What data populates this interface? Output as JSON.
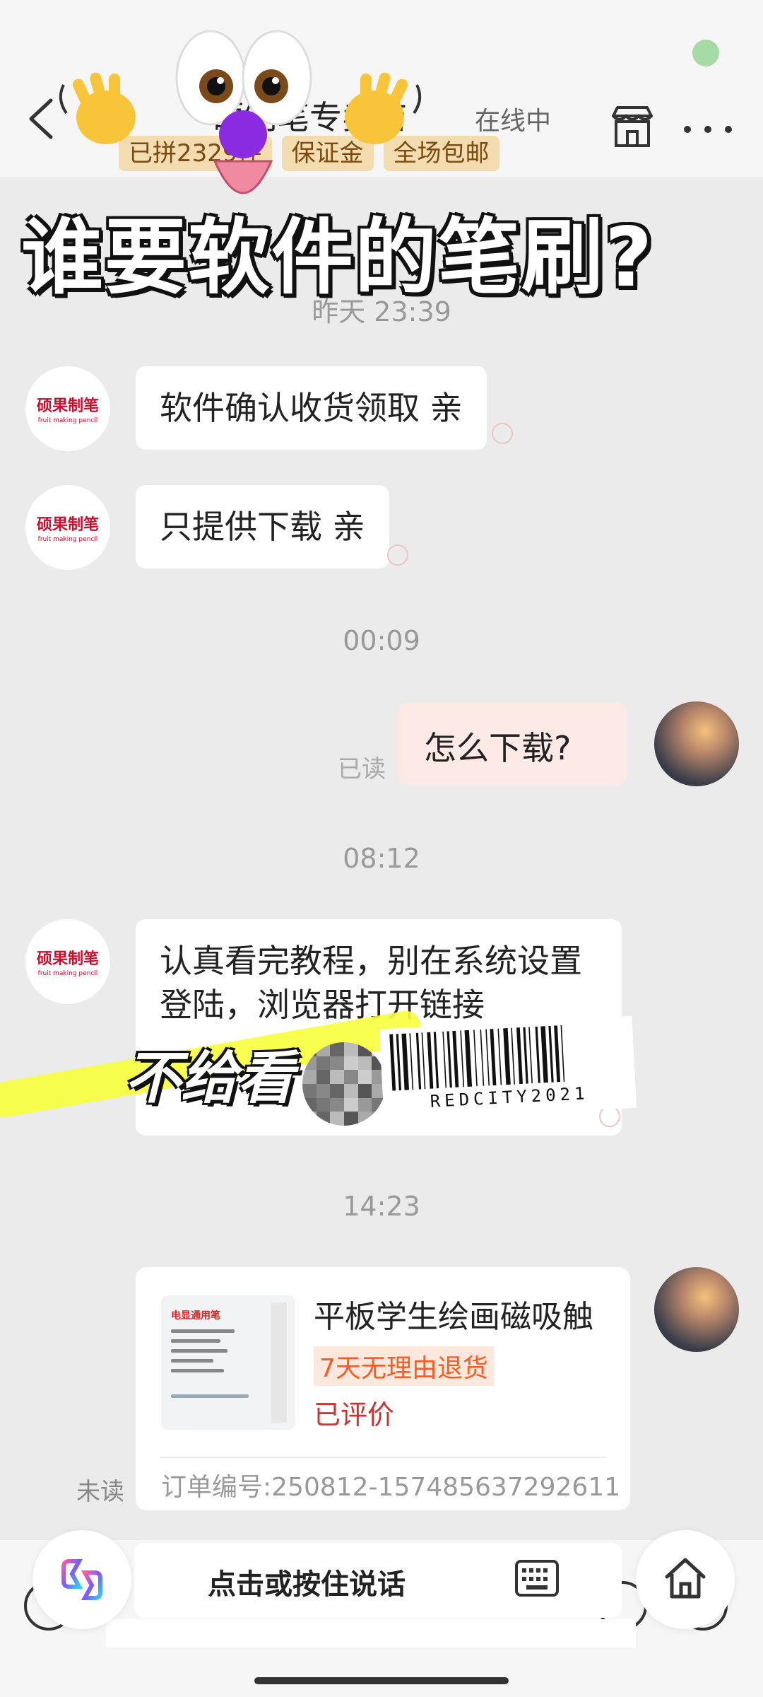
{
  "header": {
    "shop_name": "硕制笔专卖店",
    "online_status": "在线中",
    "tags": [
      "已拼2329件",
      "保证金",
      "全场包邮"
    ],
    "icons": [
      "back-icon",
      "store-icon",
      "more-icon"
    ]
  },
  "overlay": {
    "caption": "谁要软件的笔刷?",
    "sticker_text": "不给看",
    "barcode_text": "REDCITY2021"
  },
  "shop_logo": {
    "text": "硕果制笔",
    "sub": "fruit making pencil"
  },
  "messages": {
    "ts1": "昨天 23:39",
    "m1": "软件确认收货领取 亲",
    "m2": "只提供下载 亲",
    "ts2": "00:09",
    "m3": "怎么下载?",
    "m3_status": "已读",
    "ts3": "08:12",
    "m4": "认真看完教程，别在系统设置登陆，浏览器打开链接",
    "ts4": "14:23"
  },
  "product": {
    "title": "平板学生绘画磁吸触",
    "badge": "7天无理由退货",
    "status": "已评价",
    "order": "订单编号:250812-157485637292611",
    "status_unread": "未读",
    "img_title": "电显通用笔"
  },
  "input_bar": {
    "voice_label": "点击或按住说话",
    "icons": [
      "app-icon",
      "keyboard-icon",
      "home-icon"
    ]
  },
  "colors": {
    "bubble_out": "#fde9e6",
    "tag_bg": "#f3dcb0",
    "badge_text": "#ff5a1f",
    "status_red": "#d03030"
  }
}
